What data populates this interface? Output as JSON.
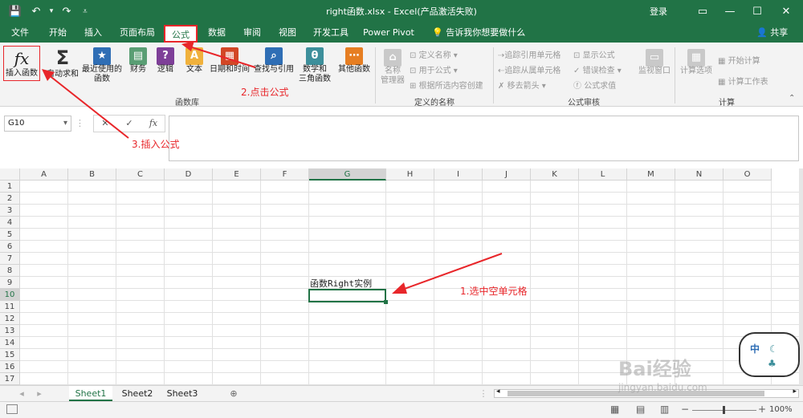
{
  "titlebar": {
    "save_icon": "save-icon",
    "undo_icon": "undo-icon",
    "redo_icon": "redo-icon",
    "customize_icon": "customize-icon",
    "title": "right函数.xlsx  -  Excel(产品激活失败)",
    "login": "登录",
    "ribbon_display_icon": "ribbon-display-icon",
    "minimize_icon": "minimize-icon",
    "maximize_icon": "maximize-icon",
    "close_icon": "close-icon"
  },
  "tabs": [
    "文件",
    "开始",
    "插入",
    "页面布局",
    "公式",
    "数据",
    "审阅",
    "视图",
    "开发工具",
    "Power Pivot"
  ],
  "active_tab": "公式",
  "tellme": "告诉我你想要做什么",
  "share": "共享",
  "ribbon": {
    "insert_function": "插入函数",
    "autosum": "自动求和",
    "recent_1": "最近使用的",
    "recent_2": "函数",
    "financial": "财务",
    "logical": "逻辑",
    "text": "文本",
    "datetime": "日期和时间",
    "lookup": "查找与引用",
    "math_1": "数学和",
    "math_2": "三角函数",
    "more": "其他函数",
    "group_library": "函数库",
    "name_manager_1": "名称",
    "name_manager_2": "管理器",
    "define_name": "定义名称",
    "use_in_formula": "用于公式",
    "create_from_selection": "根据所选内容创建",
    "group_names": "定义的名称",
    "trace_precedents": "追踪引用单元格",
    "trace_dependents": "追踪从属单元格",
    "remove_arrows": "移去箭头",
    "show_formulas": "显示公式",
    "error_checking": "错误检查",
    "evaluate_formula": "公式求值",
    "group_auditing": "公式审核",
    "watch_window": "监视窗口",
    "calc_options": "计算选项",
    "calc_now": "开始计算",
    "calc_sheet": "计算工作表",
    "group_calc": "计算"
  },
  "formula_bar": {
    "name_box": "G10",
    "cancel": "✕",
    "enter": "✓",
    "fx": "fx",
    "value": ""
  },
  "columns": [
    "A",
    "B",
    "C",
    "D",
    "E",
    "F",
    "G",
    "H",
    "I",
    "J",
    "K",
    "L",
    "M",
    "N",
    "O"
  ],
  "rows": [
    "1",
    "2",
    "3",
    "4",
    "5",
    "6",
    "7",
    "8",
    "9",
    "10",
    "11",
    "12",
    "13",
    "14",
    "15",
    "16",
    "17"
  ],
  "cells": {
    "G9": "函数Right实例"
  },
  "selected_cell": "G10",
  "sheets": [
    "Sheet1",
    "Sheet2",
    "Sheet3"
  ],
  "active_sheet": "Sheet1",
  "zoom": "100%",
  "annotations": {
    "step1": "1.选中空单元格",
    "step2": "2.点击公式",
    "step3": "3.插入公式"
  },
  "watermark": {
    "text": "Bai经验",
    "sub": "jingyan.baidu.com"
  },
  "ime": {
    "lang": "中"
  },
  "colors": {
    "excel_green": "#217346",
    "annotation_red": "#e8262a"
  }
}
